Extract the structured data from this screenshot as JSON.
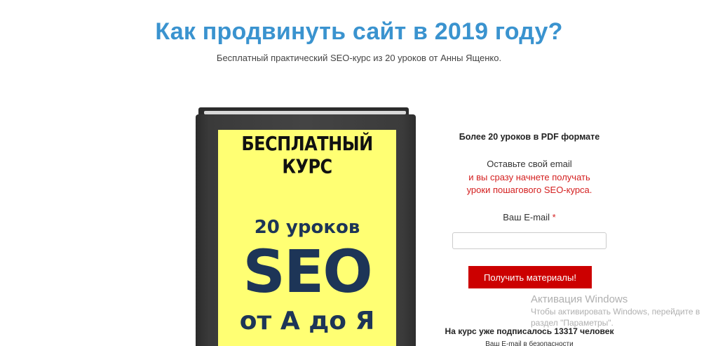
{
  "header": {
    "title": "Как продвинуть сайт в 2019 году?",
    "subtitle": "Бесплатный практический SEO-курс из 20 уроков от Анны Ященко."
  },
  "book": {
    "heading": "БЕСПЛАТНЫЙ КУРС",
    "lessons": "20 уроков",
    "seo": "SEO",
    "a_to_z": "от А до Я"
  },
  "form": {
    "pdf_heading": "Более 20 уроков в PDF формате",
    "leave_email": "Оставьте свой email",
    "promise_line1": "и вы сразу начнете получать",
    "promise_line2": "уроки пошагового SEO-курса.",
    "email_label": "Ваш E-mail",
    "required_mark": "*",
    "email_value": "",
    "submit_label": "Получить материалы!",
    "subscribed_text": "На курс уже подписалось 13317 человек",
    "safety_text": "Ваш E-mail в безопасности"
  },
  "watermark": {
    "title": "Активация Windows",
    "line1": "Чтобы активировать Windows, перейдите в",
    "line2": "раздел \"Параметры\"."
  },
  "colors": {
    "title_blue": "#3a93cf",
    "book_yellow": "#ffff73",
    "book_navy": "#1d3557",
    "accent_red": "#cc0000"
  }
}
